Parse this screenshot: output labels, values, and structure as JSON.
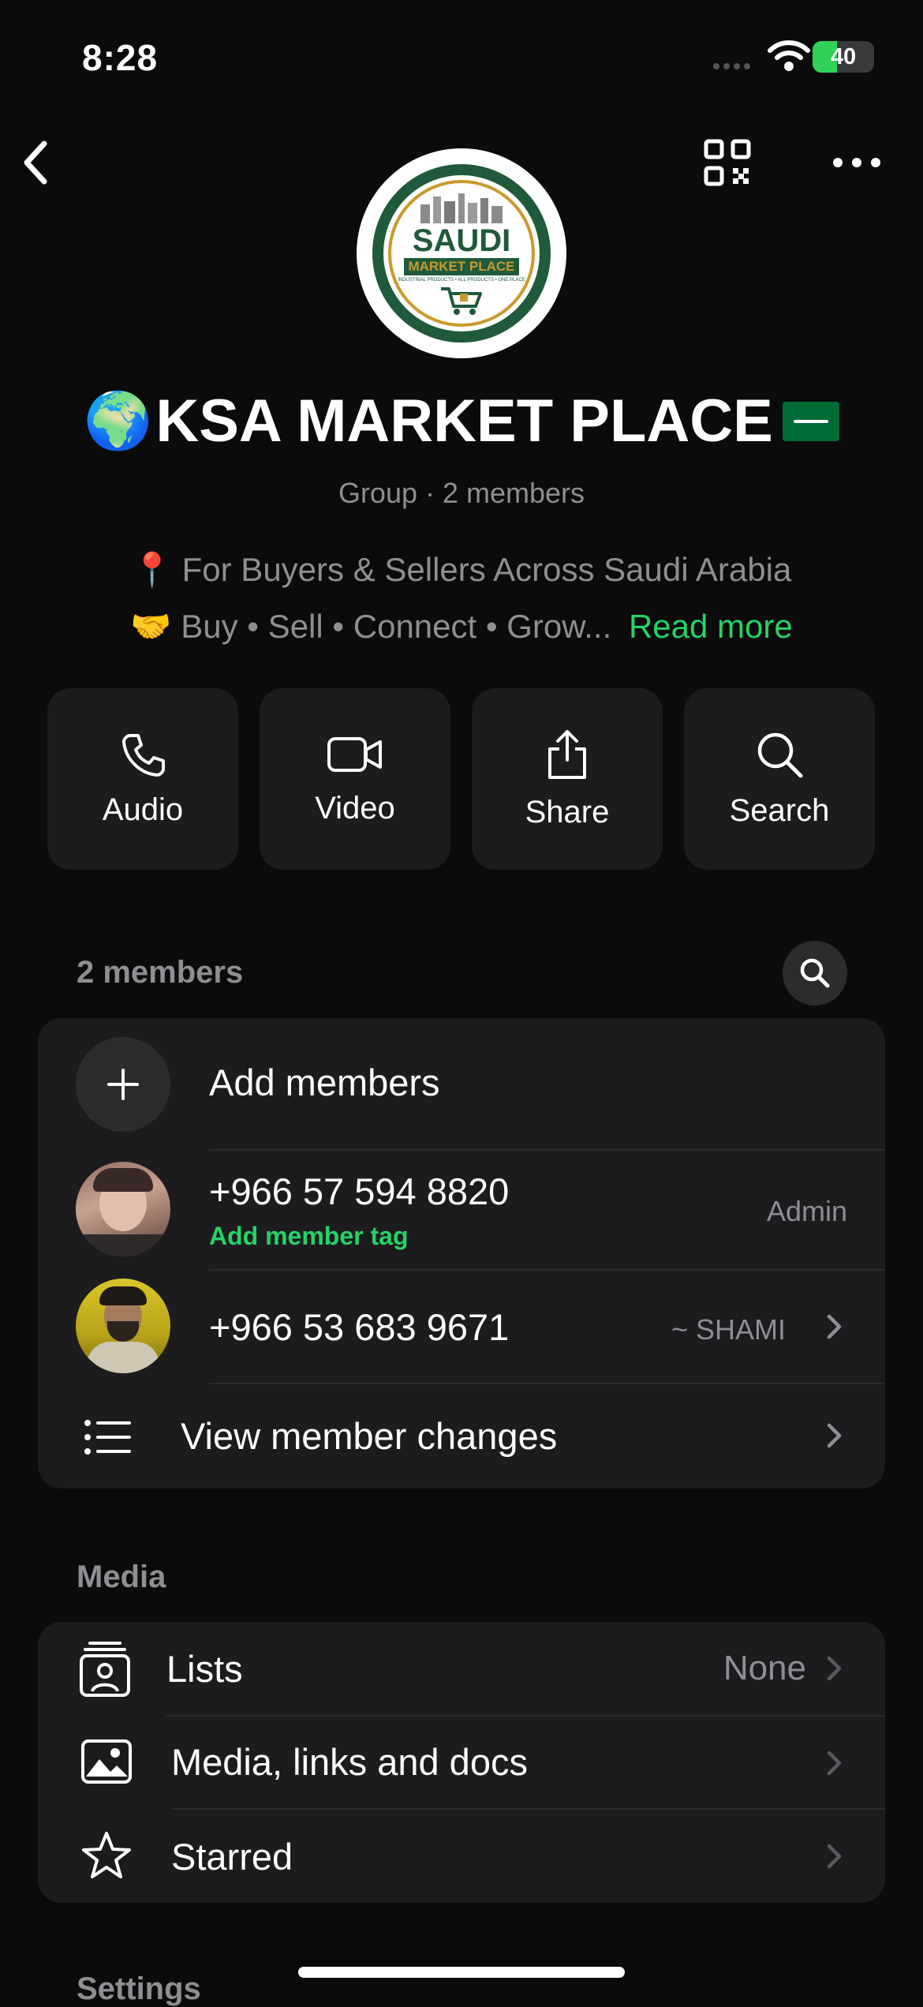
{
  "status_bar": {
    "time": "8:28",
    "battery_percent": "40"
  },
  "profile": {
    "name": "KSA MARKET PLACE",
    "name_prefix_emoji": "🌍",
    "name_suffix_emoji": "🇸🇦",
    "meta": "Group · 2 members",
    "description_line1": "📍 For Buyers & Sellers Across Saudi Arabia",
    "description_line2": "🤝 Buy • Sell • Connect • Grow...",
    "read_more": "Read more",
    "logo": {
      "title": "SAUDI",
      "subtitle": "MARKET PLACE",
      "tagline": "INDUSTRIAL PRODUCTS • ALL PRODUCTS • ONE PLACE"
    }
  },
  "actions": [
    {
      "label": "Audio",
      "icon": "phone-icon"
    },
    {
      "label": "Video",
      "icon": "video-icon"
    },
    {
      "label": "Share",
      "icon": "share-icon"
    },
    {
      "label": "Search",
      "icon": "search-icon"
    }
  ],
  "members_section": {
    "title": "2 members",
    "add_members": "Add members",
    "members": [
      {
        "phone": "+966 57 594 8820",
        "tag_link": "Add member tag",
        "role": "Admin"
      },
      {
        "phone": "+966 53 683 9671",
        "nickname": "~ SHAMI"
      }
    ],
    "view_changes": "View member changes"
  },
  "media_section": {
    "title": "Media",
    "items": [
      {
        "label": "Lists",
        "value": "None",
        "icon": "lists-icon"
      },
      {
        "label": "Media, links and docs",
        "icon": "image-icon"
      },
      {
        "label": "Starred",
        "icon": "star-icon"
      }
    ]
  },
  "settings_section": {
    "title": "Settings"
  },
  "colors": {
    "background": "#0b0b0b",
    "card": "#1c1c1e",
    "accent": "#25d366",
    "muted": "#8e8e93"
  }
}
